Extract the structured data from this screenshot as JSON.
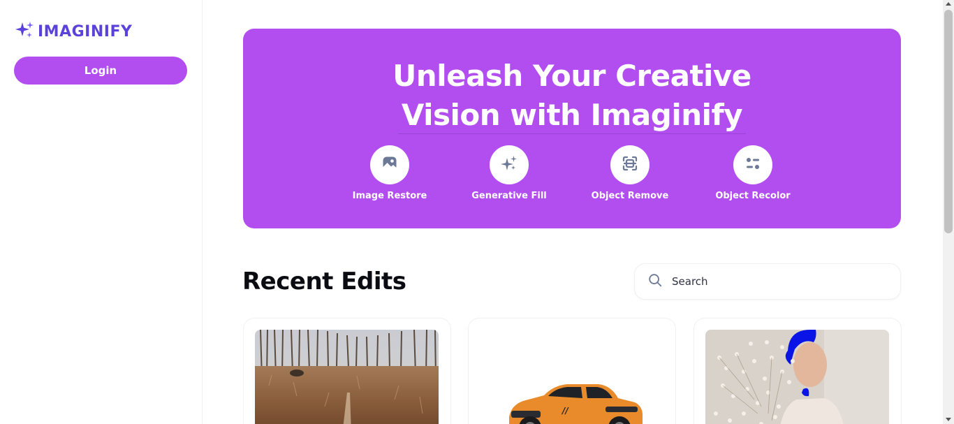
{
  "app": {
    "name": "IMAGINIFY"
  },
  "sidebar": {
    "login_label": "Login"
  },
  "hero": {
    "title_line1": "Unleash Your Creative",
    "title_line2": "Vision with Imaginify",
    "tools": [
      {
        "label": "Image Restore",
        "icon": "image-icon"
      },
      {
        "label": "Generative Fill",
        "icon": "sparkles-icon"
      },
      {
        "label": "Object Remove",
        "icon": "scan-icon"
      },
      {
        "label": "Object Recolor",
        "icon": "filter-icon"
      }
    ]
  },
  "recent": {
    "title": "Recent Edits",
    "search": {
      "placeholder": "Search",
      "value": ""
    },
    "items": [
      {
        "image": "field-landscape-photo"
      },
      {
        "image": "orange-car-photo"
      },
      {
        "image": "woman-flowers-photo"
      }
    ]
  },
  "colors": {
    "accent": "#b24ef0",
    "logo": "#5b43d9",
    "icon": "#6b7896"
  }
}
